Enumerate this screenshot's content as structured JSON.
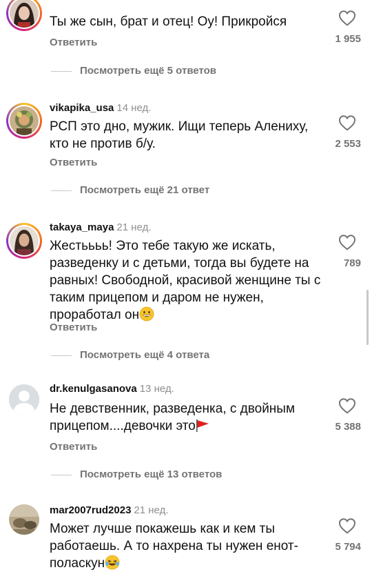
{
  "comments": [
    {
      "username": "",
      "time": "",
      "text": "Ты же сын, брат и отец! Оу! Прикройся",
      "reply_label": "Ответить",
      "likes": "1 955",
      "more_replies": "Посмотреть ещё 5 ответов"
    },
    {
      "username": "vikapika_usa",
      "time": "14 нед.",
      "text": "РСП это дно, мужик. Ищи теперь Алениху, кто не против б/у.",
      "reply_label": "Ответить",
      "likes": "2 553",
      "more_replies": "Посмотреть ещё 21 ответ"
    },
    {
      "username": "takaya_maya",
      "time": "21 нед.",
      "text": "Жестьььь! Это тебе такую же искать, разведенку и с детьми, тогда вы будете на равных! Свободной, красивой женщине ты с таким прицепом и даром не нужен, проработал он",
      "text_emoji": "grinning-face",
      "reply_label": "Ответить",
      "likes": "789",
      "more_replies": "Посмотреть ещё 4 ответа"
    },
    {
      "username": "dr.kenulgasanova",
      "time": "13 нед.",
      "text": "Не девственник, разведенка, с двойным прицепом....девочки это",
      "text_emoji": "red-flag",
      "reply_label": "Ответить",
      "likes": "5 388",
      "more_replies": "Посмотреть ещё 13 ответов"
    },
    {
      "username": "mar2007rud2023",
      "time": "21 нед.",
      "text": "Может лучше покажешь как и кем ты работаешь. А то нахрена ты нужен енот-поласкун",
      "text_emoji": "laughing-tears-face",
      "likes": "5 794"
    }
  ],
  "icons": {
    "like": "heart-outline-icon"
  },
  "colors": {
    "text": "#111111",
    "muted": "#737373",
    "timestamp": "#8e8e8e",
    "story_ring": [
      "#f9c42b",
      "#f56a1e",
      "#d6267a",
      "#8a35c7"
    ],
    "red_flag": "#e0201c",
    "emoji_yellow": "#f7c52b"
  }
}
